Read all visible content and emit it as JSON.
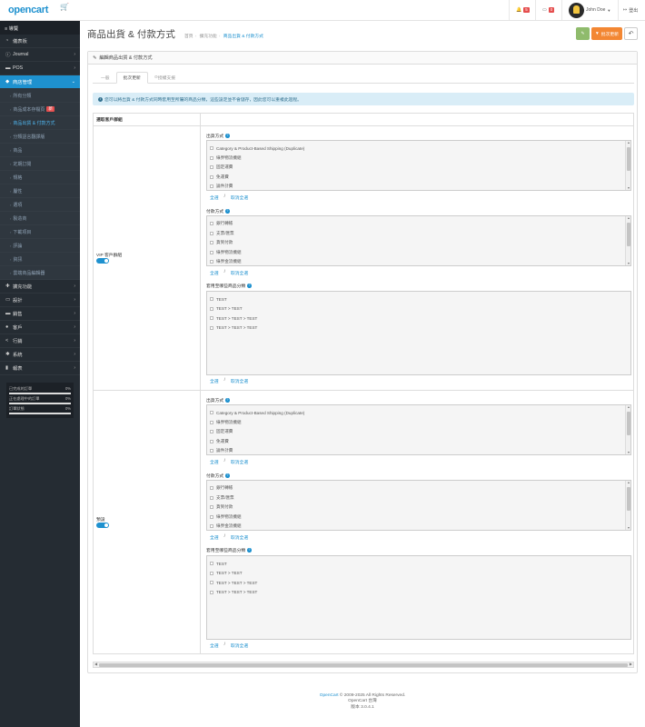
{
  "header": {
    "logo": "opencart",
    "bell_count": "5",
    "alert_count": "0",
    "user_name": "John Doe",
    "logout_label": "登出"
  },
  "sidebar": {
    "nav_label": "導覽",
    "items": [
      {
        "label": "儀表板",
        "icon": "dashboard-icon"
      },
      {
        "label": "Journal",
        "icon": "info-icon"
      },
      {
        "label": "POS",
        "icon": "cart-icon"
      },
      {
        "label": "商店管理",
        "icon": "tags-icon"
      }
    ],
    "submenu": [
      "所有分類",
      "商品成本存檔頁",
      "商品出貨 & 付款方式",
      "分類語言翻譯版",
      "商品",
      "定期訂閱",
      "規格",
      "屬性",
      "選項",
      "製造商",
      "下載項目",
      "評論",
      "資訊",
      "雲端商品編輯器"
    ],
    "submenu_badge": "新",
    "items_after": [
      {
        "label": "擴充功能",
        "icon": "puzzle-icon"
      },
      {
        "label": "設計",
        "icon": "monitor-icon"
      },
      {
        "label": "銷售",
        "icon": "cart-icon"
      },
      {
        "label": "客戶",
        "icon": "user-icon"
      },
      {
        "label": "行銷",
        "icon": "share-icon"
      },
      {
        "label": "系統",
        "icon": "gear-icon"
      },
      {
        "label": "報表",
        "icon": "bar-chart-icon"
      }
    ],
    "stats": [
      {
        "label": "已完成的訂單",
        "value": "0%",
        "fraction": 0
      },
      {
        "label": "正在處理中的訂單",
        "value": "0%",
        "fraction": 0
      },
      {
        "label": "訂單狀態",
        "value": "0%",
        "fraction": 0
      }
    ]
  },
  "page": {
    "title": "商品出貨 & 付款方式",
    "breadcrumb": [
      "首頁",
      "擴充功能",
      "商品出貨 & 付款方式"
    ],
    "save_icon": "floppy-icon",
    "batch_update_label": "批次更新",
    "back_icon": "reply-icon"
  },
  "panel": {
    "heading": "編輯商品出貨 & 付款方式",
    "tabs": [
      "一般",
      "批次更新",
      "授權支援"
    ],
    "alert": "您可以將出貨 & 付款方式同時套用至所屬的商品分類，這些設定並不會儲存，因此您可以重複此過程。",
    "column_header": "選取客戶群組",
    "groups": [
      {
        "name": "VIP 客戶群組",
        "shipping_title": "出貨方式",
        "shipping": [
          "Category & Product-Based Shipping (Duplicate)",
          "綠界物流機組",
          "固定運費",
          "免運費",
          "論件計費"
        ],
        "payment_title": "付款方式",
        "payment": [
          "銀行轉帳",
          "支票/匯票",
          "貨到付款",
          "綠界物流機組",
          "綠界金流機組"
        ],
        "category_title": "套用至哪些商品分類",
        "categories": [
          "TEST",
          "TEST  >  TEST",
          "TEST  >  TEST  >  TEST",
          "TEST  >  TEST  >  TEST"
        ],
        "select_all": "全選",
        "unselect_all": "取消全選"
      },
      {
        "name": "預設",
        "shipping_title": "出貨方式",
        "shipping": [
          "Category & Product-Based Shipping (Duplicate)",
          "綠界物流機組",
          "固定運費",
          "免運費",
          "論件計費"
        ],
        "payment_title": "付款方式",
        "payment": [
          "銀行轉帳",
          "支票/匯票",
          "貨到付款",
          "綠界物流機組",
          "綠界金流機組"
        ],
        "category_title": "套用至哪些商品分類",
        "categories": [
          "TEST",
          "TEST  >  TEST",
          "TEST  >  TEST  >  TEST",
          "TEST  >  TEST  >  TEST"
        ],
        "select_all": "全選",
        "unselect_all": "取消全選"
      }
    ]
  },
  "footer": {
    "brand": "OpenCart",
    "copyright": " © 2009-2025 All Rights Reserved.",
    "line2": "OpenCart 台灣",
    "version": "版本 3.0.4.1"
  },
  "colors": {
    "accent": "#1e91cf",
    "success": "#8fbb6c",
    "warning": "#f38733",
    "sidebar": "#252c33"
  }
}
